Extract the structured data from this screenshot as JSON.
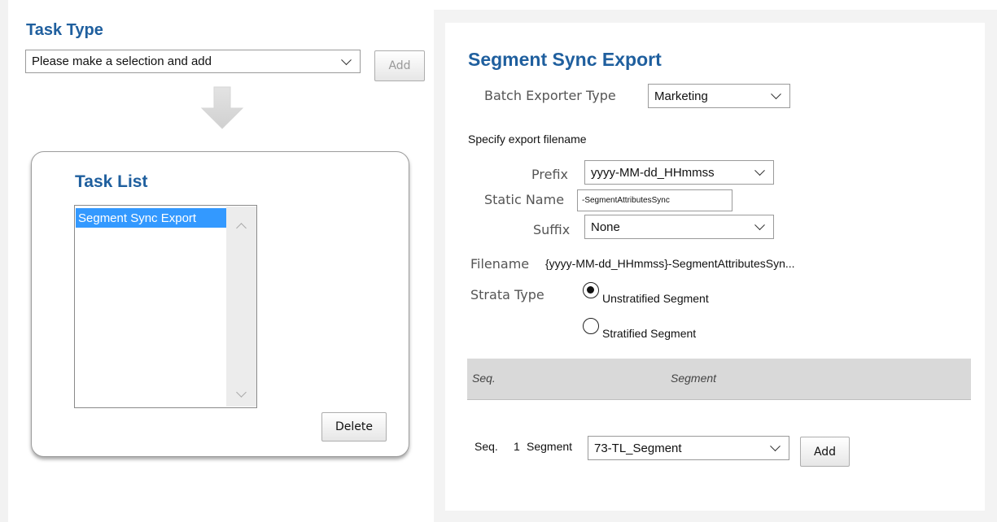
{
  "left": {
    "task_type_title": "Task Type",
    "task_type_select_value": "Please make a selection and add",
    "add_button": "Add",
    "task_list_title": "Task List",
    "task_list_items": [
      "Segment Sync Export"
    ],
    "delete_button": "Delete"
  },
  "right": {
    "title": "Segment Sync Export",
    "batch_exporter_type_label": "Batch Exporter Type",
    "batch_exporter_type_value": "Marketing",
    "specify_filename_label": "Specify export filename",
    "prefix_label": "Prefix",
    "prefix_value": "yyyy-MM-dd_HHmmss",
    "static_name_label": "Static Name",
    "static_name_value": "-SegmentAttributesSync",
    "suffix_label": "Suffix",
    "suffix_value": "None",
    "filename_label": "Filename",
    "filename_value": "{yyyy-MM-dd_HHmmss}-SegmentAttributesSyn...",
    "strata_type_label": "Strata Type",
    "strata_options": [
      "Unstratified Segment",
      "Stratified Segment"
    ],
    "strata_selected": "Unstratified Segment",
    "grid_headers": [
      "Seq.",
      "Segment"
    ],
    "seq_label": "Seq.",
    "seq_number": "1",
    "segment_label": "Segment",
    "segment_value": "73-TL_Segment",
    "add_button": "Add"
  },
  "colors": {
    "title_blue": "#1f5f9e",
    "selection_blue": "#3399ff"
  },
  "icons": {
    "arrow": "down-arrow-icon",
    "dropdown": "chevron-down-icon"
  }
}
